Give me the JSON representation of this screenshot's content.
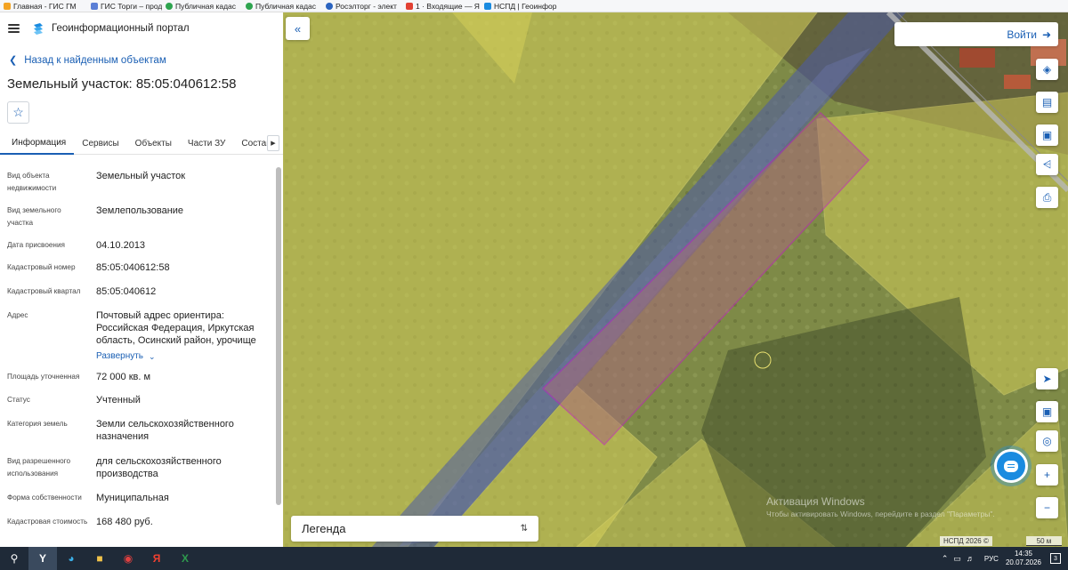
{
  "bookmarks": [
    {
      "label": "Главная - ГИС ГМ",
      "color": "#f3a323"
    },
    {
      "label": "ГИС Торги – прод",
      "color": "#5b7fd6"
    },
    {
      "label": "Публичная кадас",
      "color": "#2ea44f"
    },
    {
      "label": "Публичная кадас",
      "color": "#2ea44f"
    },
    {
      "label": "Росэлторг - элект",
      "color": "#2b64c0"
    },
    {
      "label": "1 · Входящие — Я",
      "color": "#e24133"
    },
    {
      "label": "НСПД | Геоинфор",
      "color": "#1a8be0"
    }
  ],
  "header": {
    "portal_title": "Геоинформационный портал"
  },
  "back_link": "Назад к найденным объектам",
  "object_title": "Земельный участок: 85:05:040612:58",
  "tabs": [
    {
      "label": "Информация",
      "active": true
    },
    {
      "label": "Сервисы",
      "active": false
    },
    {
      "label": "Объекты",
      "active": false
    },
    {
      "label": "Части ЗУ",
      "active": false
    },
    {
      "label": "Состав",
      "active": false
    }
  ],
  "properties": [
    {
      "label": "Вид объекта недвижимости",
      "value": "Земельный участок"
    },
    {
      "label": "Вид земельного участка",
      "value": "Землепользование"
    },
    {
      "label": "Дата присвоения",
      "value": "04.10.2013"
    },
    {
      "label": "Кадастровый номер",
      "value": "85:05:040612:58"
    },
    {
      "label": "Кадастровый квартал",
      "value": "85:05:040612"
    },
    {
      "label": "Адрес",
      "value": "Почтовый адрес ориентира: Российская Федерация, Иркутская область, Осинский район, урочище"
    },
    {
      "label": "Площадь уточненная",
      "value": "72 000 кв. м"
    },
    {
      "label": "Статус",
      "value": "Учтенный"
    },
    {
      "label": "Категория земель",
      "value": "Земли сельскохозяйственного назначения"
    },
    {
      "label": "Вид разрешенного использования",
      "value": "для сельскохозяйственного производства"
    },
    {
      "label": "Форма собственности",
      "value": "Муниципальная"
    },
    {
      "label": "Кадастровая стоимость",
      "value": "168 480 руб."
    }
  ],
  "expand_label": "Развернуть",
  "map": {
    "login_label": "Войти",
    "legend_label": "Легенда",
    "watermark_title": "Активация Windows",
    "watermark_text": "Чтобы активировать Windows, перейдите в раздел \"Параметры\".",
    "copyright": "НСПД 2026 ©",
    "scale": "50 м",
    "colors": {
      "parcel_fill": "#d8d25a",
      "selected_outline": "#c020c0",
      "road_overlay": "#4a5aa8"
    }
  },
  "tray": {
    "lang": "РУС",
    "time": "14:35",
    "date": "20.07.2026",
    "notifications": "3"
  }
}
